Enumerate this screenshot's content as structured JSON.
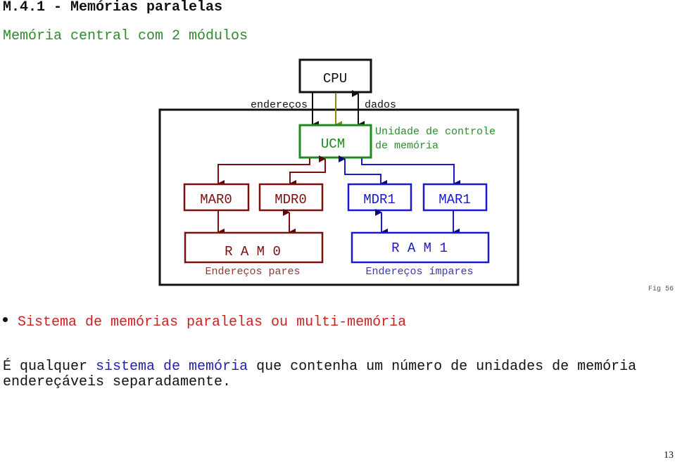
{
  "page": {
    "title": "M.4.1 - Memórias paralelas",
    "subtitle": "Memória central com 2 módulos",
    "fig_label": "Fig 56",
    "page_number": "13"
  },
  "diagram": {
    "colors": {
      "black": "#111111",
      "green": "#1f8a1f",
      "olive": "#8a8a10",
      "red": "#7a1010",
      "blue": "#1a1acc",
      "navy": "#0a0a7a"
    },
    "cpu": {
      "label": "CPU"
    },
    "ucm": {
      "label": "UCM",
      "description_line1": "Unidade de controle",
      "description_line2": "de memória"
    },
    "bus_labels": {
      "addresses": "endereços",
      "data": "dados"
    },
    "registers": [
      {
        "id": "mar0",
        "label": "MAR0",
        "module": 0
      },
      {
        "id": "mdr0",
        "label": "MDR0",
        "module": 0
      },
      {
        "id": "mdr1",
        "label": "MDR1",
        "module": 1
      },
      {
        "id": "mar1",
        "label": "MAR1",
        "module": 1
      }
    ],
    "rams": [
      {
        "id": "ram0",
        "label": "R A M 0",
        "caption": "Endereços pares"
      },
      {
        "id": "ram1",
        "label": "R A M 1",
        "caption": "Endereços ímpares"
      }
    ]
  },
  "bullet": {
    "text": "Sistema de memórias paralelas ou multi-memória"
  },
  "paragraph": {
    "part1": "É qualquer ",
    "highlight": "sistema de memória",
    "part2": " que contenha um número de unidades de memória endereçáveis separadamente."
  }
}
